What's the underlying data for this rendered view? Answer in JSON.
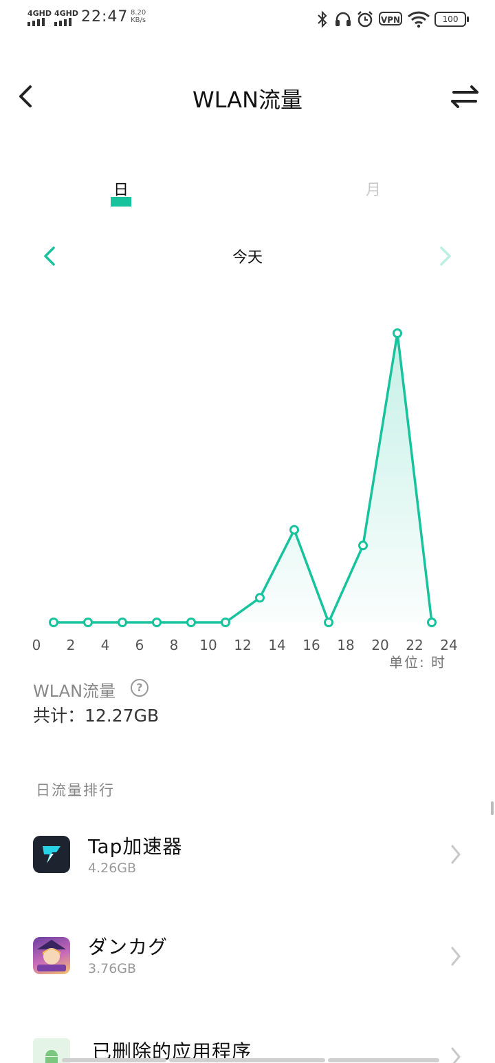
{
  "status_bar": {
    "signal_1": "4GHD",
    "signal_2": "4GHD",
    "time": "22:47",
    "speed_value": "8.20",
    "speed_unit": "KB/s",
    "vpn": "VPN",
    "battery": "100"
  },
  "header": {
    "title": "WLAN流量"
  },
  "tabs": [
    {
      "label": "日",
      "active": true
    },
    {
      "label": "月",
      "active": false
    }
  ],
  "date_nav": {
    "label": "今天"
  },
  "colors": {
    "accent": "#17c39c"
  },
  "chart_data": {
    "type": "area",
    "x_ticks": [
      "0",
      "2",
      "4",
      "6",
      "8",
      "10",
      "12",
      "14",
      "16",
      "18",
      "20",
      "22",
      "24"
    ],
    "xlim": [
      0,
      24
    ],
    "unit_label": "单位:  时",
    "x": [
      1,
      3,
      5,
      7,
      9,
      11,
      13,
      15,
      17,
      19,
      21,
      23
    ],
    "values": [
      0,
      0,
      0,
      0,
      0,
      0,
      0.085,
      0.32,
      0,
      0.266,
      1.0,
      0
    ]
  },
  "summary": {
    "label": "WLAN流量",
    "help": "?",
    "total": "共计：12.27GB"
  },
  "ranking": {
    "title": "日流量排行",
    "items": [
      {
        "name": "Tap加速器",
        "usage": "4.26GB"
      },
      {
        "name": "ダンカグ",
        "usage": "3.76GB"
      },
      {
        "name": "已删除的应用程序",
        "usage": ""
      }
    ]
  }
}
